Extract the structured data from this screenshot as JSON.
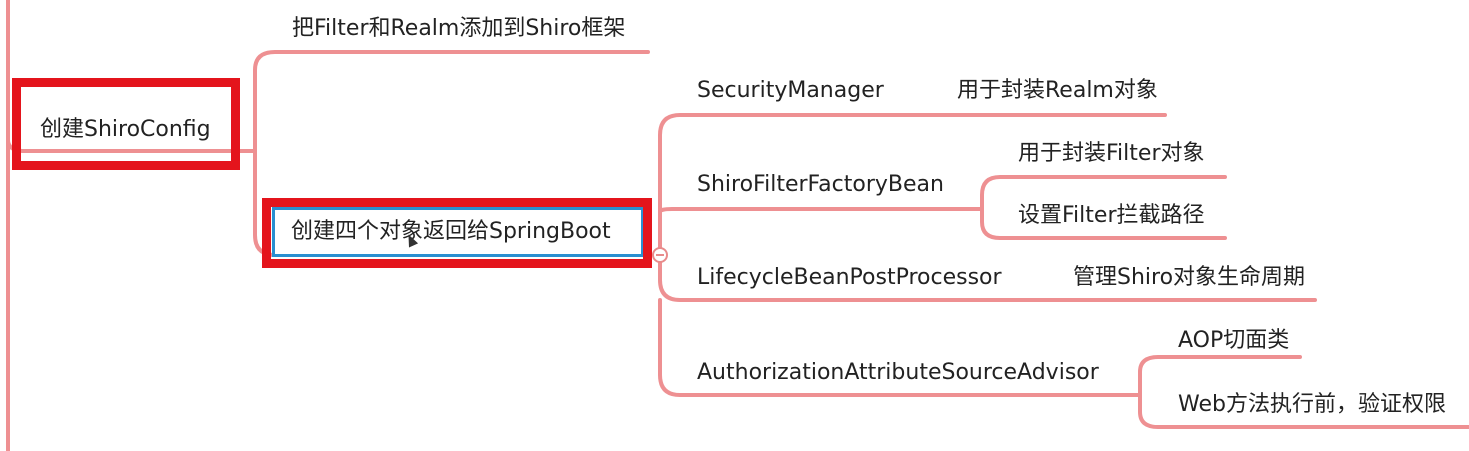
{
  "root": {
    "label": "创建ShiroConfig"
  },
  "branches": {
    "add_filter": "把Filter和Realm添加到Shiro框架",
    "create_four": "创建四个对象返回给SpringBoot"
  },
  "objects": [
    {
      "name": "SecurityManager",
      "desc": [
        "用于封装Realm对象"
      ]
    },
    {
      "name": "ShiroFilterFactoryBean",
      "desc": [
        "用于封装Filter对象",
        "设置Filter拦截路径"
      ]
    },
    {
      "name": "LifecycleBeanPostProcessor",
      "desc": [
        "管理Shiro对象生命周期"
      ]
    },
    {
      "name": "AuthorizationAttributeSourceAdvisor",
      "desc": [
        "AOP切面类",
        "Web方法执行前，验证权限"
      ]
    }
  ],
  "colors": {
    "connector": "#ee9092",
    "highlight": "#e4141c",
    "selection": "#2a8fd0"
  },
  "icons": {
    "collapse": "collapse-minus-icon",
    "cursor": "mouse-cursor-icon"
  }
}
